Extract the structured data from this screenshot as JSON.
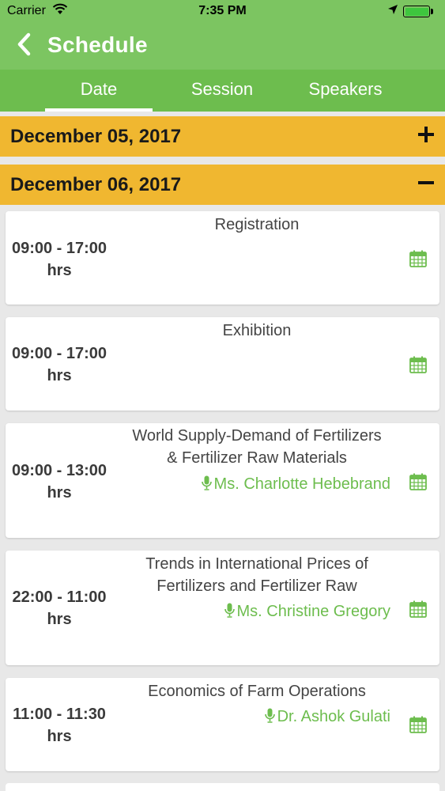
{
  "status_bar": {
    "carrier": "Carrier",
    "time": "7:35 PM"
  },
  "nav": {
    "title": "Schedule",
    "back_icon": "chevron-left-icon"
  },
  "tabs": [
    {
      "label": "Date",
      "active": true
    },
    {
      "label": "Session",
      "active": false
    },
    {
      "label": "Speakers",
      "active": false
    }
  ],
  "days": [
    {
      "label": "December 05, 2017",
      "expanded": false,
      "toggle_icon": "plus-icon"
    },
    {
      "label": "December 06, 2017",
      "expanded": true,
      "toggle_icon": "minus-icon"
    }
  ],
  "sessions": [
    {
      "time": "09:00 - 17:00",
      "unit": "hrs",
      "title_lines": [
        "Registration"
      ],
      "speaker": ""
    },
    {
      "time": "09:00 - 17:00",
      "unit": "hrs",
      "title_lines": [
        "Exhibition"
      ],
      "speaker": ""
    },
    {
      "time": "09:00 - 13:00",
      "unit": "hrs",
      "title_lines": [
        "World Supply-Demand of Fertilizers",
        "& Fertilizer Raw Materials"
      ],
      "speaker": "Ms. Charlotte Hebebrand"
    },
    {
      "time": "22:00 - 11:00",
      "unit": "hrs",
      "title_lines": [
        "Trends in International Prices of",
        "Fertilizers and Fertilizer Raw"
      ],
      "speaker": "Ms. Christine Gregory"
    },
    {
      "time": "11:00 - 11:30",
      "unit": "hrs",
      "title_lines": [
        "Economics of Farm Operations"
      ],
      "speaker": "Dr. Ashok Gulati"
    }
  ],
  "colors": {
    "primary_green": "#7cc561",
    "tab_green": "#6dbd4e",
    "date_header": "#f0b730",
    "speaker_green": "#6dbd4e"
  }
}
